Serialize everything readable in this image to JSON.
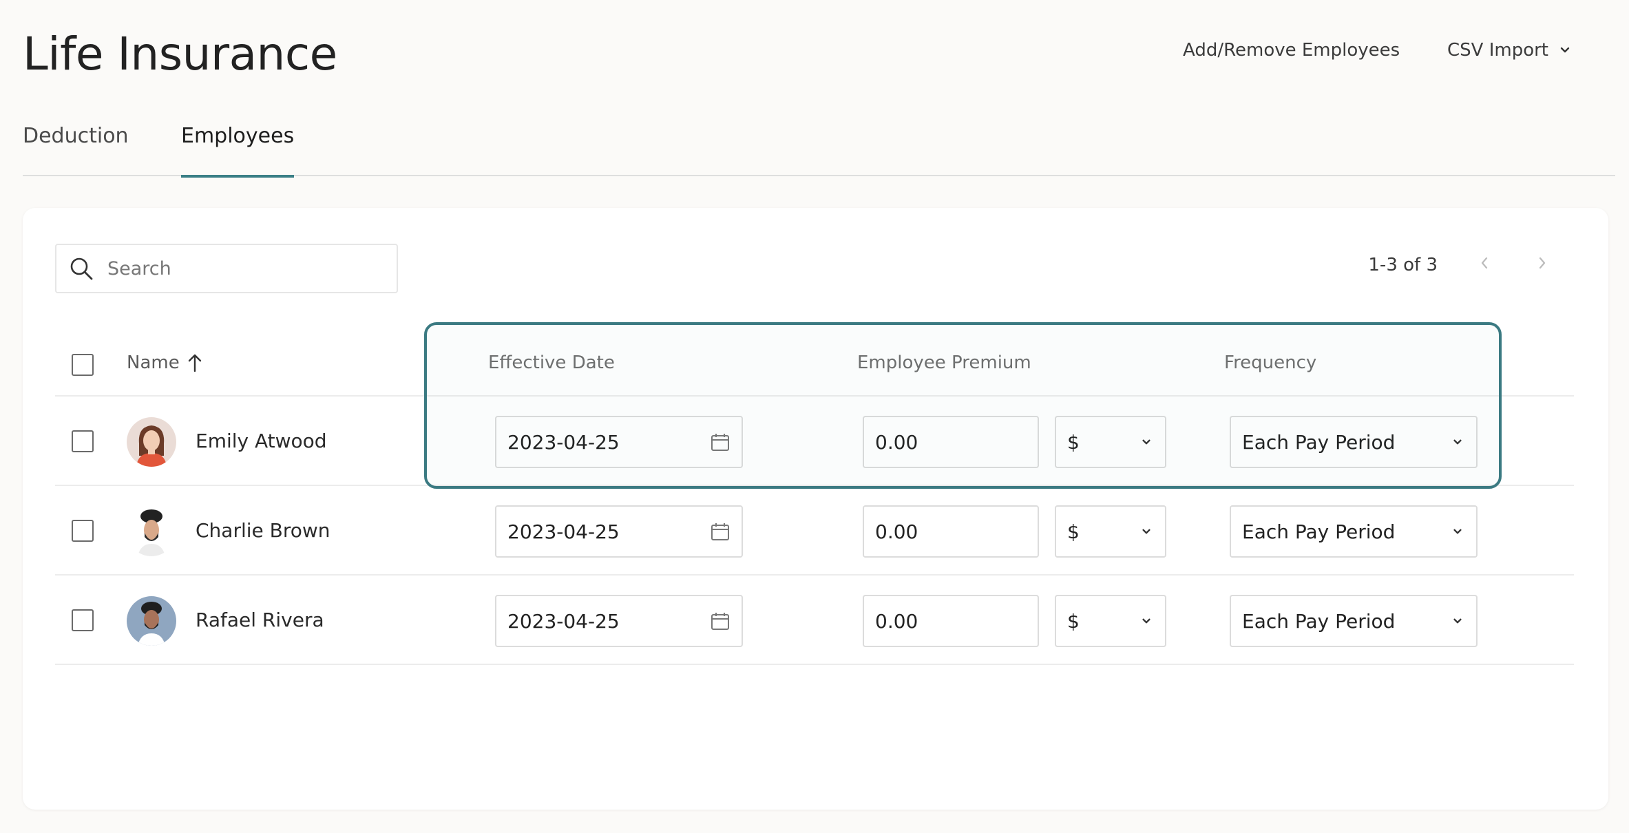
{
  "header": {
    "title": "Life Insurance",
    "add_remove_label": "Add/Remove Employees",
    "csv_import_label": "CSV Import"
  },
  "tabs": [
    {
      "label": "Deduction",
      "active": false
    },
    {
      "label": "Employees",
      "active": true
    }
  ],
  "search": {
    "placeholder": "Search",
    "value": ""
  },
  "pagination": {
    "label": "1-3 of 3"
  },
  "table": {
    "columns": {
      "name": "Name",
      "effective_date": "Effective Date",
      "employee_premium": "Employee Premium",
      "frequency": "Frequency"
    },
    "rows": [
      {
        "name": "Emily Atwood",
        "effective_date": "2023-04-25",
        "premium": "0.00",
        "unit": "$",
        "frequency": "Each Pay Period"
      },
      {
        "name": "Charlie Brown",
        "effective_date": "2023-04-25",
        "premium": "0.00",
        "unit": "$",
        "frequency": "Each Pay Period"
      },
      {
        "name": "Rafael Rivera",
        "effective_date": "2023-04-25",
        "premium": "0.00",
        "unit": "$",
        "frequency": "Each Pay Period"
      }
    ]
  },
  "colors": {
    "accent": "#3a7f86",
    "highlight_border": "#3b7a82",
    "background": "#fbfaf8"
  }
}
